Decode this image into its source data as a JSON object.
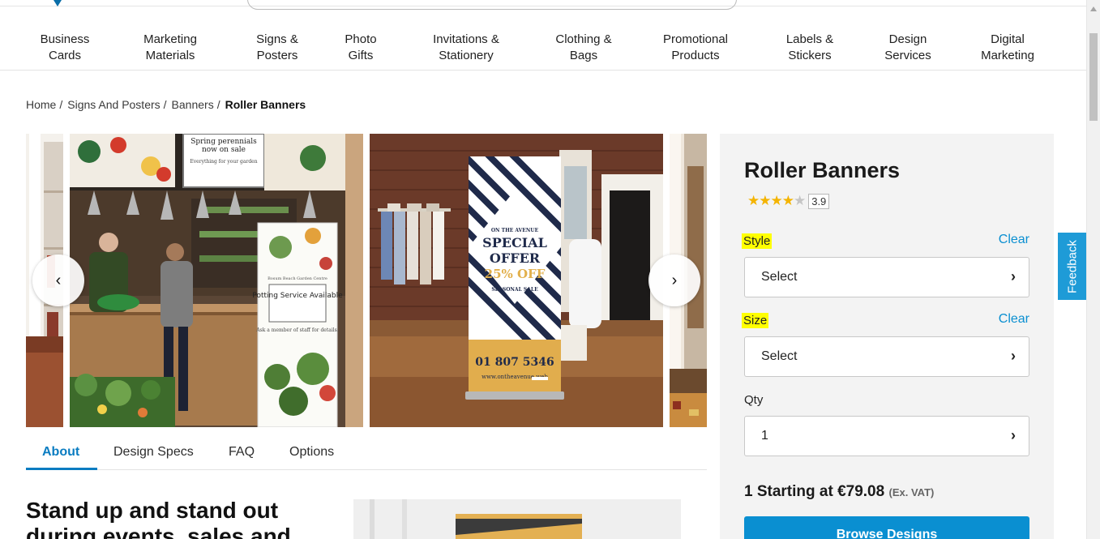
{
  "nav": {
    "items": [
      {
        "line1": "Business",
        "line2": "Cards"
      },
      {
        "line1": "Marketing",
        "line2": "Materials"
      },
      {
        "line1": "Signs &",
        "line2": "Posters"
      },
      {
        "line1": "Photo",
        "line2": "Gifts"
      },
      {
        "line1": "Invitations &",
        "line2": "Stationery"
      },
      {
        "line1": "Clothing &",
        "line2": "Bags"
      },
      {
        "line1": "Promotional",
        "line2": "Products"
      },
      {
        "line1": "Labels &",
        "line2": "Stickers"
      },
      {
        "line1": "Design",
        "line2": "Services"
      },
      {
        "line1": "Digital",
        "line2": "Marketing"
      }
    ]
  },
  "breadcrumb": {
    "home": "Home",
    "level1": "Signs And Posters",
    "level2": "Banners",
    "current": "Roller Banners",
    "separator": "/"
  },
  "gallery": {
    "slide1": {
      "top_sign_line1": "Spring perennials",
      "top_sign_line2": "now on sale",
      "top_sign_line3": "Everything for your garden",
      "banner_small": "Bosum Beach Garden Centre",
      "banner_title": "Potting Service Available",
      "banner_sub": "Ask a member of staff for details."
    },
    "slide2": {
      "line1": "ON THE AVENUE",
      "line2": "SPECIAL",
      "line3": "OFFER",
      "line4": "25% OFF",
      "line5": "SEASONAL SALE",
      "phone": "01 807 5346",
      "web": "www.ontheavenue.web"
    },
    "prev_icon": "chevron-left-icon",
    "next_icon": "chevron-right-icon",
    "prev_glyph": "‹",
    "next_glyph": "›"
  },
  "tabs": [
    "About",
    "Design Specs",
    "FAQ",
    "Options"
  ],
  "about": {
    "headline": "Stand up and stand out during events, sales and"
  },
  "product": {
    "title": "Roller Banners",
    "rating": 3.9,
    "rating_text": "3.9",
    "stars_filled": "★★★★",
    "stars_empty": "★",
    "style_label": "Style",
    "style_value": "Select",
    "size_label": "Size",
    "size_value": "Select",
    "qty_label": "Qty",
    "qty_value": "1",
    "clear_label": "Clear",
    "chevron_glyph": "›",
    "price_text": "1 Starting at €79.08",
    "price_note": "(Ex. VAT)",
    "browse_label": "Browse Designs"
  },
  "feedback_label": "Feedback",
  "colors": {
    "accent": "#0a8fd1",
    "tab_active": "#0a7cc1",
    "highlight": "#ffff00",
    "star": "#f4b400"
  }
}
